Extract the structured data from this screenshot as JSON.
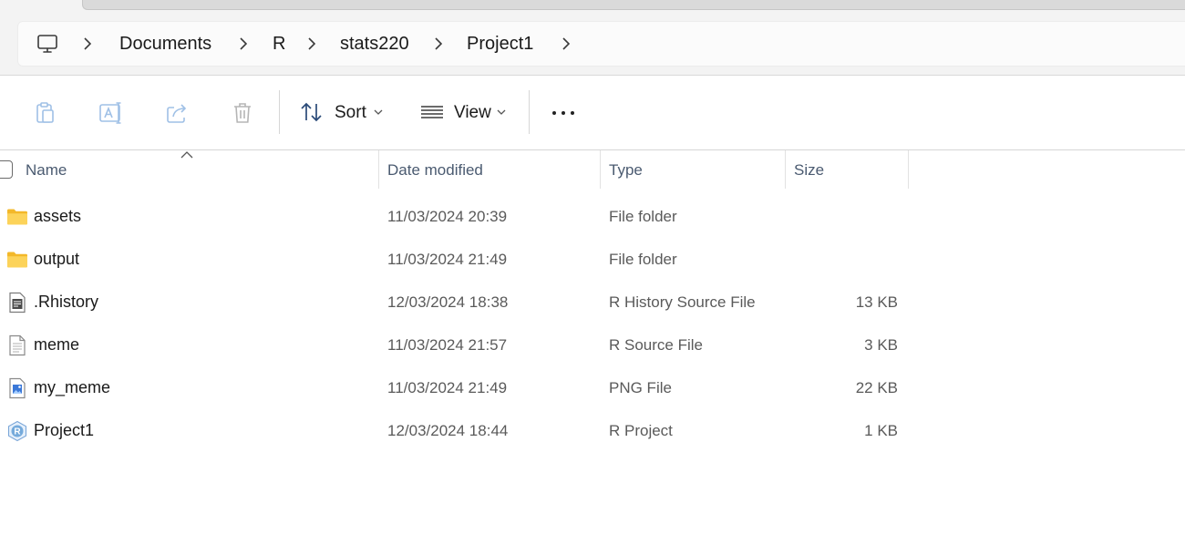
{
  "breadcrumb": {
    "root_icon": "computer-icon",
    "items": [
      "Documents",
      "R",
      "stats220",
      "Project1"
    ]
  },
  "toolbar": {
    "actions": [
      "paste-icon",
      "rename-icon",
      "share-icon",
      "delete-icon"
    ],
    "sort_label": "Sort",
    "view_label": "View",
    "more_icon": "more-icon"
  },
  "columns": {
    "name": "Name",
    "date": "Date modified",
    "type": "Type",
    "size": "Size"
  },
  "files": [
    {
      "name": "assets",
      "date": "11/03/2024 20:39",
      "type": "File folder",
      "size": "",
      "icon": "folder-icon"
    },
    {
      "name": "output",
      "date": "11/03/2024 21:49",
      "type": "File folder",
      "size": "",
      "icon": "folder-icon"
    },
    {
      "name": ".Rhistory",
      "date": "12/03/2024 18:38",
      "type": "R History Source File",
      "size": "13 KB",
      "icon": "rhistory-file-icon"
    },
    {
      "name": "meme",
      "date": "11/03/2024 21:57",
      "type": "R Source File",
      "size": "3 KB",
      "icon": "text-file-icon"
    },
    {
      "name": "my_meme",
      "date": "11/03/2024 21:49",
      "type": "PNG File",
      "size": "22 KB",
      "icon": "image-file-icon"
    },
    {
      "name": "Project1",
      "date": "12/03/2024 18:44",
      "type": "R Project",
      "size": "1 KB",
      "icon": "rproject-file-icon"
    }
  ],
  "colors": {
    "folder": "#F8C93E",
    "header_text": "#4A5A70",
    "accent": "#3B78D8"
  }
}
